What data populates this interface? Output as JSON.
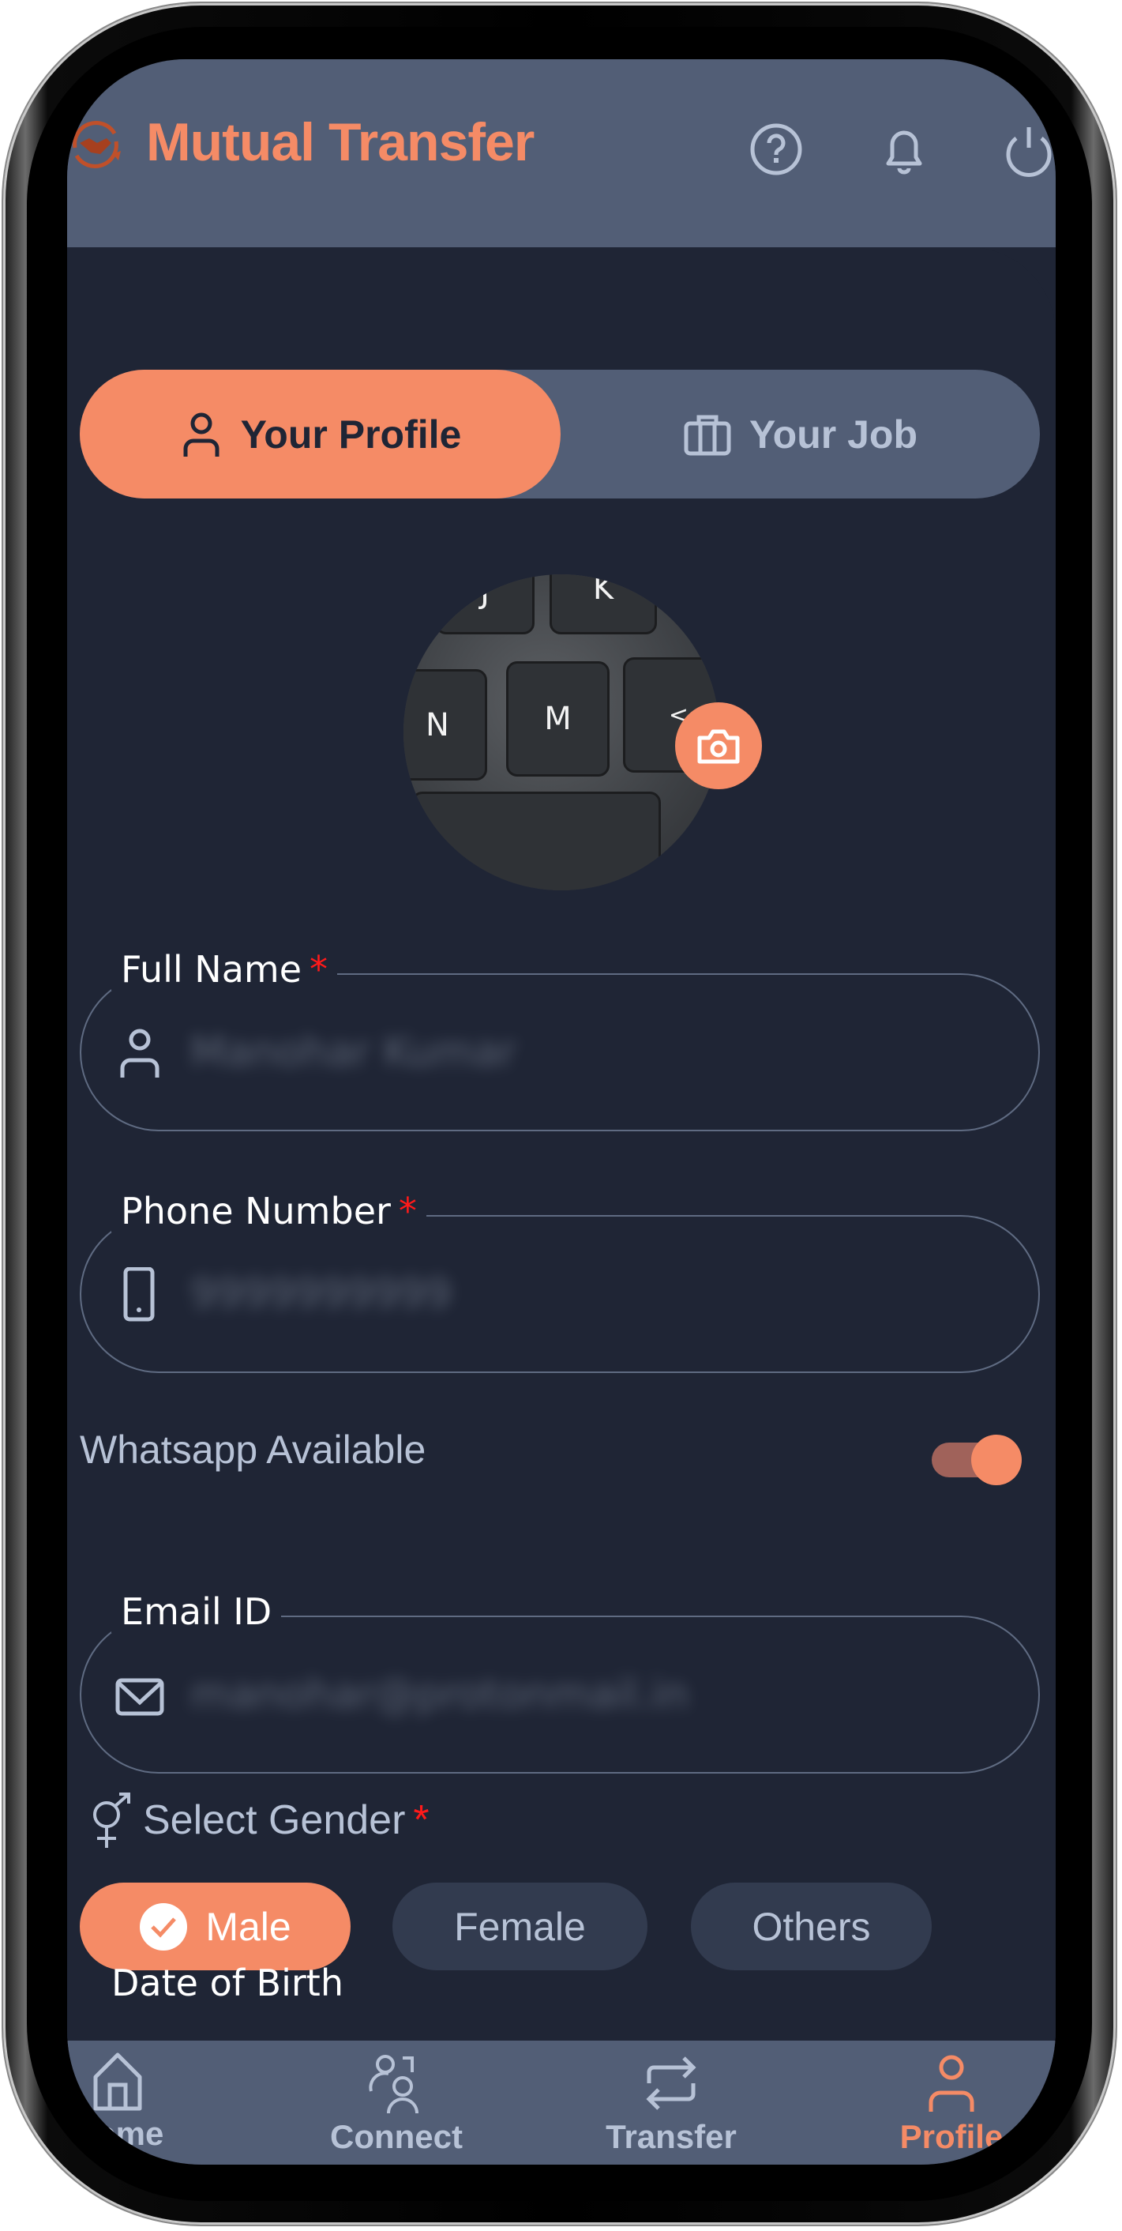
{
  "header": {
    "app_title": "Mutual Transfer",
    "icons": [
      "help-circle-icon",
      "bell-icon",
      "power-icon"
    ]
  },
  "tabs": [
    {
      "label": "Your Profile",
      "icon": "user-icon",
      "active": true
    },
    {
      "label": "Your Job",
      "icon": "briefcase-icon",
      "active": false
    }
  ],
  "avatar": {
    "photo_keys": [
      "J",
      "K",
      "N",
      "M",
      "<"
    ],
    "edit_icon": "camera-icon"
  },
  "form": {
    "full_name": {
      "label": "Full Name",
      "required": "*",
      "value": "Manohar Kumar",
      "icon": "user-icon"
    },
    "phone": {
      "label": "Phone Number",
      "required": "*",
      "value": "9999999999",
      "icon": "mobile-icon"
    },
    "whatsapp": {
      "label": "Whatsapp Available",
      "enabled": true
    },
    "email": {
      "label": "Email ID",
      "required": "",
      "value": "manohar@protonmail.in",
      "icon": "mail-icon"
    },
    "gender": {
      "label": "Select Gender",
      "required": "*",
      "options": [
        "Male",
        "Female",
        "Others"
      ],
      "selected": "Male"
    },
    "dob": {
      "label": "Date of Birth"
    }
  },
  "bottom_nav": [
    {
      "label": "Home",
      "icon": "home-icon",
      "active": false
    },
    {
      "label": "Connect",
      "icon": "people-icon",
      "active": false
    },
    {
      "label": "Transfer",
      "icon": "transfer-icon",
      "active": false
    },
    {
      "label": "Profile",
      "icon": "user-icon",
      "active": true
    }
  ],
  "colors": {
    "accent": "#f58b66",
    "header_bg": "#525e76",
    "page_bg": "#1f2535",
    "muted": "#b7c2d6",
    "required": "#ff1a1a"
  }
}
